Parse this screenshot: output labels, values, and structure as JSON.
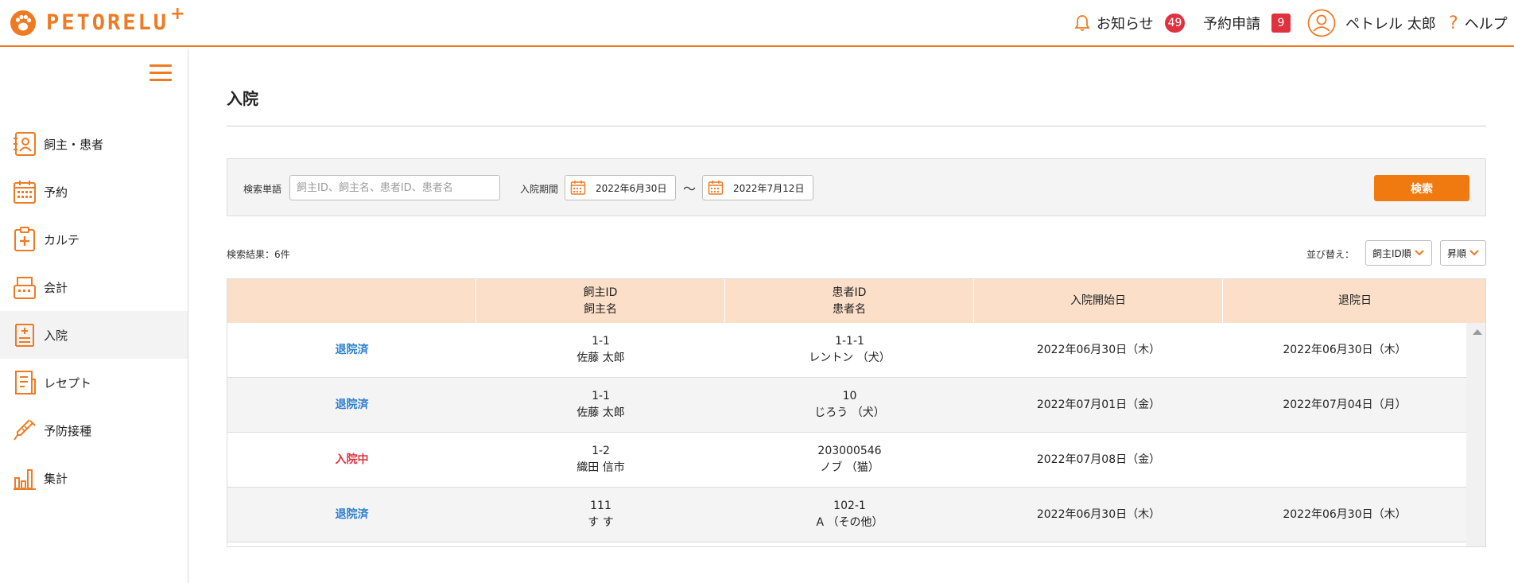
{
  "header": {
    "logo_text": "PETORELU",
    "logo_plus": "+",
    "notifications": {
      "label": "お知らせ",
      "count": "49"
    },
    "reservations": {
      "label": "予約申請",
      "count": "9"
    },
    "user_name": "ペトレル 太郎",
    "help_label": "ヘルプ"
  },
  "sidebar": {
    "items": [
      {
        "label": "飼主・患者",
        "icon": "owner-patient-icon"
      },
      {
        "label": "予約",
        "icon": "calendar-icon"
      },
      {
        "label": "カルテ",
        "icon": "medical-chart-icon"
      },
      {
        "label": "会計",
        "icon": "register-icon"
      },
      {
        "label": "入院",
        "icon": "hospitalization-icon",
        "active": true
      },
      {
        "label": "レセプト",
        "icon": "receipt-icon"
      },
      {
        "label": "予防接種",
        "icon": "syringe-icon"
      },
      {
        "label": "集計",
        "icon": "bar-chart-icon"
      }
    ]
  },
  "main": {
    "title": "入院",
    "search": {
      "keyword_label": "検索単語",
      "keyword_placeholder": "飼主ID、飼主名、患者ID、患者名",
      "keyword_value": "",
      "period_label": "入院期間",
      "date_from": "2022年6月30日",
      "separator": "～",
      "date_to": "2022年7月12日",
      "button_label": "検索"
    },
    "result_count": "検索結果：6件",
    "sort": {
      "label": "並び替え：",
      "field": "飼主ID順",
      "order": "昇順"
    },
    "table": {
      "headers": [
        {
          "line1": "",
          "line2": ""
        },
        {
          "line1": "飼主ID",
          "line2": "飼主名"
        },
        {
          "line1": "患者ID",
          "line2": "患者名"
        },
        {
          "line1": "入院開始日",
          "line2": ""
        },
        {
          "line1": "退院日",
          "line2": ""
        }
      ],
      "rows": [
        {
          "status": "退院済",
          "status_type": "done",
          "owner_id": "1-1",
          "owner_name": "佐藤 太郎",
          "patient_id": "1-1-1",
          "patient_name": "レントン （犬）",
          "start": "2022年06月30日（木）",
          "end": "2022年06月30日（木）"
        },
        {
          "status": "退院済",
          "status_type": "done",
          "owner_id": "1-1",
          "owner_name": "佐藤 太郎",
          "patient_id": "10",
          "patient_name": "じろう （犬）",
          "start": "2022年07月01日（金）",
          "end": "2022年07月04日（月）"
        },
        {
          "status": "入院中",
          "status_type": "in",
          "owner_id": "1-2",
          "owner_name": "織田 信市",
          "patient_id": "203000546",
          "patient_name": "ノブ （猫）",
          "start": "2022年07月08日（金）",
          "end": ""
        },
        {
          "status": "退院済",
          "status_type": "done",
          "owner_id": "111",
          "owner_name": "す す",
          "patient_id": "102-1",
          "patient_name": "A （その他）",
          "start": "2022年06月30日（木）",
          "end": "2022年06月30日（木）"
        }
      ]
    }
  },
  "colors": {
    "accent": "#f07a22",
    "button": "#f07a10",
    "badge": "#e0323e",
    "table_header": "#fbdfc9",
    "status_done": "#2a7ecf",
    "status_in": "#e0323e"
  }
}
